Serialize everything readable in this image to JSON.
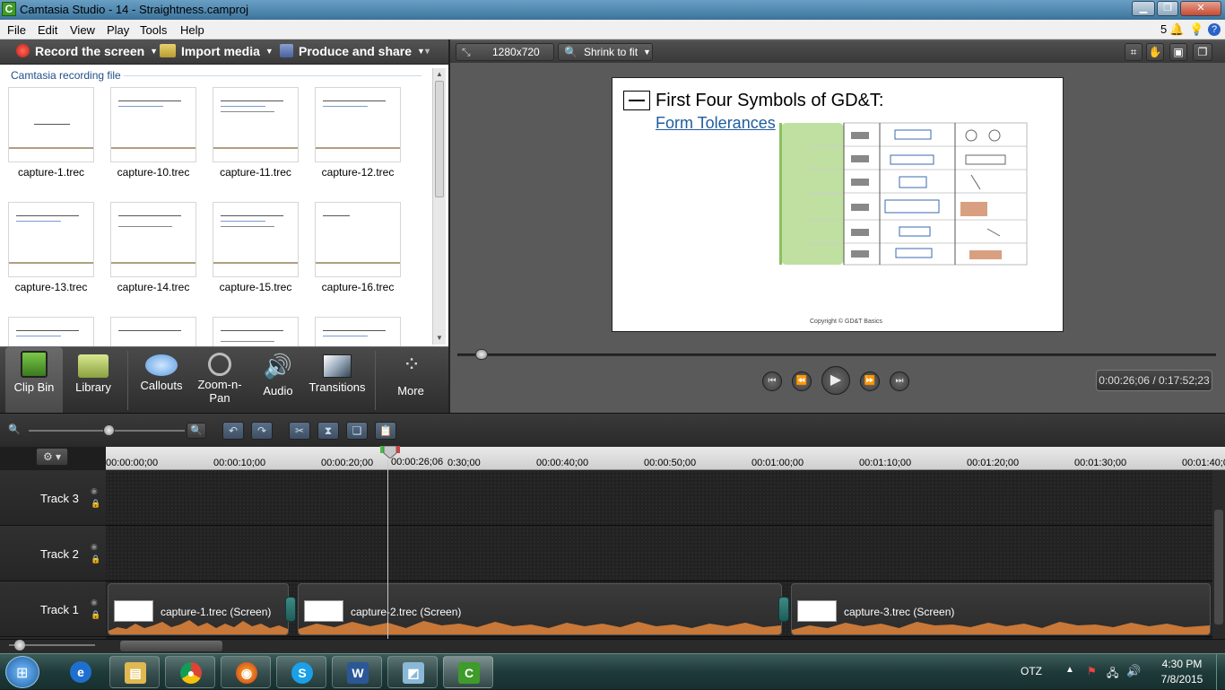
{
  "window": {
    "title": "Camtasia Studio - 14 - Straightness.camproj",
    "app_icon": "C",
    "notifications_count": "5"
  },
  "menu": [
    "File",
    "Edit",
    "View",
    "Play",
    "Tools",
    "Help"
  ],
  "toolbar": {
    "record": "Record the screen",
    "import": "Import media",
    "produce": "Produce and share"
  },
  "clip_bin": {
    "header": "Camtasia recording file",
    "clips": [
      "capture-1.trec",
      "capture-10.trec",
      "capture-11.trec",
      "capture-12.trec",
      "capture-13.trec",
      "capture-14.trec",
      "capture-15.trec",
      "capture-16.trec"
    ]
  },
  "tool_tabs": [
    {
      "label": "Clip Bin",
      "icon": "clip-bin-icon"
    },
    {
      "label": "Library",
      "icon": "library-icon"
    },
    {
      "label": "Callouts",
      "icon": "callouts-icon"
    },
    {
      "label": "Zoom-n-Pan",
      "icon": "zoom-icon"
    },
    {
      "label": "Audio",
      "icon": "audio-icon"
    },
    {
      "label": "Transitions",
      "icon": "transitions-icon"
    },
    {
      "label": "More",
      "icon": "more-icon"
    }
  ],
  "preview": {
    "dimensions": "1280x720",
    "fit_mode": "Shrink to fit",
    "slide_title": "First Four Symbols of GD&T:",
    "slide_subtitle": "Form Tolerances",
    "slide_copyright": "Copyright © GD&T Basics",
    "time": "0:00:26;06 / 0:17:52;23"
  },
  "ruler": {
    "playhead": "00:00:26;06",
    "labels": [
      "00:00:00;00",
      "00:00:10;00",
      "00:00:20;00",
      "0:30;00",
      "00:00:40;00",
      "00:00:50;00",
      "00:01:00;00",
      "00:01:10;00",
      "00:01:20;00",
      "00:01:30;00",
      "00:01:40;00"
    ]
  },
  "tracks": [
    {
      "name": "Track 3"
    },
    {
      "name": "Track 2"
    },
    {
      "name": "Track 1"
    }
  ],
  "timeline_clips": [
    "capture-1.trec (Screen)",
    "capture-2.trec (Screen)",
    "capture-3.trec (Screen)"
  ],
  "taskbar": {
    "language": "OTZ",
    "time": "4:30 PM",
    "date": "7/8/2015"
  },
  "colors": {
    "accent_blue": "#1f5d9e",
    "audio_wave": "#c87838",
    "transition": "#3e8a86"
  }
}
